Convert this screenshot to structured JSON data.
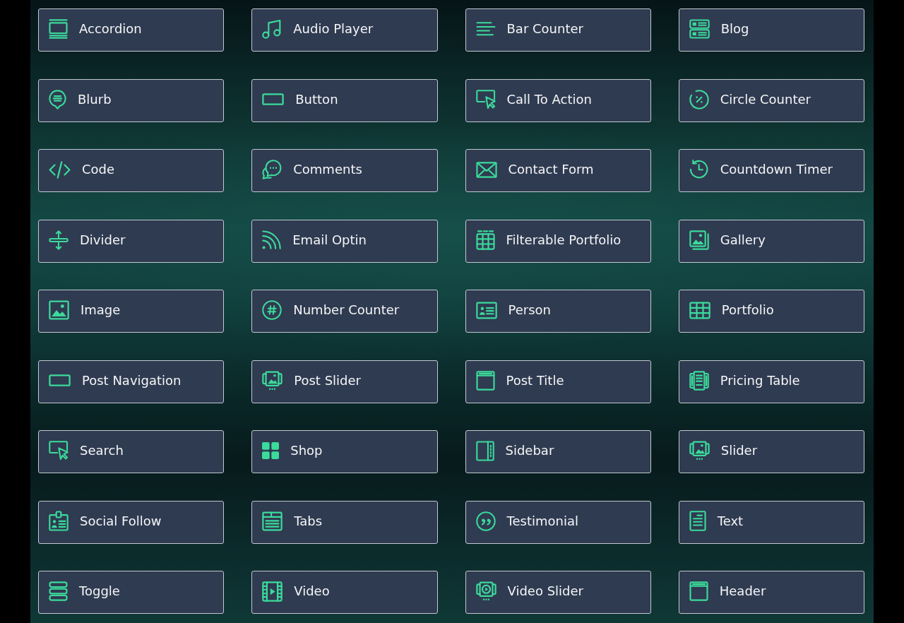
{
  "modules": [
    {
      "label": "Accordion",
      "kind": "accordion"
    },
    {
      "label": "Audio Player",
      "kind": "note"
    },
    {
      "label": "Bar Counter",
      "kind": "lines"
    },
    {
      "label": "Blog",
      "kind": "blog"
    },
    {
      "label": "Blurb",
      "kind": "bubble"
    },
    {
      "label": "Button",
      "kind": "button"
    },
    {
      "label": "Call To Action",
      "kind": "pointer"
    },
    {
      "label": "Circle Counter",
      "kind": "percent"
    },
    {
      "label": "Code",
      "kind": "code"
    },
    {
      "label": "Comments",
      "kind": "chat"
    },
    {
      "label": "Contact Form",
      "kind": "envelope"
    },
    {
      "label": "Countdown Timer",
      "kind": "clock"
    },
    {
      "label": "Divider",
      "kind": "divider"
    },
    {
      "label": "Email Optin",
      "kind": "rss"
    },
    {
      "label": "Filterable Portfolio",
      "kind": "filtergrid"
    },
    {
      "label": "Gallery",
      "kind": "gallery"
    },
    {
      "label": "Image",
      "kind": "image"
    },
    {
      "label": "Number Counter",
      "kind": "hash"
    },
    {
      "label": "Person",
      "kind": "card"
    },
    {
      "label": "Portfolio",
      "kind": "grid"
    },
    {
      "label": "Post Navigation",
      "kind": "button"
    },
    {
      "label": "Post Slider",
      "kind": "slider"
    },
    {
      "label": "Post Title",
      "kind": "window"
    },
    {
      "label": "Pricing Table",
      "kind": "pricing"
    },
    {
      "label": "Search",
      "kind": "pointer"
    },
    {
      "label": "Shop",
      "kind": "squares"
    },
    {
      "label": "Sidebar",
      "kind": "sidebar"
    },
    {
      "label": "Slider",
      "kind": "slider"
    },
    {
      "label": "Social Follow",
      "kind": "badge"
    },
    {
      "label": "Tabs",
      "kind": "tabs"
    },
    {
      "label": "Testimonial",
      "kind": "quote"
    },
    {
      "label": "Text",
      "kind": "document"
    },
    {
      "label": "Toggle",
      "kind": "stack"
    },
    {
      "label": "Video",
      "kind": "film"
    },
    {
      "label": "Video Slider",
      "kind": "videoslider"
    },
    {
      "label": "Header",
      "kind": "window"
    }
  ]
}
